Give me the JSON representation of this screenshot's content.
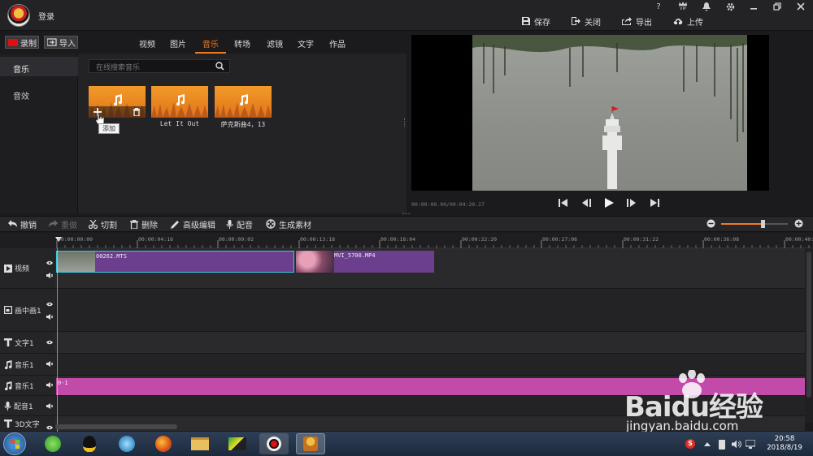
{
  "titlebar": {
    "login_label": "登录",
    "actions": [
      {
        "label": "保存",
        "icon": "save-icon"
      },
      {
        "label": "关闭",
        "icon": "close-project-icon"
      },
      {
        "label": "导出",
        "icon": "export-icon"
      },
      {
        "label": "上传",
        "icon": "upload-icon"
      }
    ],
    "vip_label": "VIP"
  },
  "toolbar": {
    "record_label": "录制",
    "import_label": "导入",
    "tabs": [
      "视频",
      "图片",
      "音乐",
      "转场",
      "滤镜",
      "文字",
      "作品"
    ],
    "active_tab": "音乐"
  },
  "library": {
    "categories": [
      "音乐",
      "音效"
    ],
    "search_placeholder": "在线搜索音乐",
    "items": [
      {
        "label": ""
      },
      {
        "label": "Let It Out"
      },
      {
        "label": "萨克斯曲4，13"
      }
    ],
    "tooltip": "添加"
  },
  "preview": {
    "timecode": "00:00:00.00/00:04:20.27"
  },
  "edit_toolbar": [
    {
      "label": "撤销",
      "icon": "undo-icon"
    },
    {
      "label": "重做",
      "icon": "redo-icon"
    },
    {
      "label": "切割",
      "icon": "scissors-icon"
    },
    {
      "label": "删除",
      "icon": "trash-icon"
    },
    {
      "label": "高级编辑",
      "icon": "pencil-icon"
    },
    {
      "label": "配音",
      "icon": "microphone-icon"
    },
    {
      "label": "生成素材",
      "icon": "reel-icon"
    }
  ],
  "zoom": {
    "level": 0.62
  },
  "timeline": {
    "ticks": [
      "00:00:00:00",
      "00:00:04:16",
      "00:00:09:02",
      "00:00:13:18",
      "00:00:18:04",
      "00:00:22:20",
      "00:00:27:06",
      "00:00:31:22",
      "00:00:36:08",
      "00:00:40:"
    ],
    "tracks": [
      {
        "label": "视频",
        "icon": "video-track-icon"
      },
      {
        "label": "画中画1",
        "icon": "pip-track-icon"
      },
      {
        "label": "文字1",
        "icon": "text-track-icon"
      },
      {
        "label": "音乐1",
        "icon": "music-track-icon"
      },
      {
        "label": "音乐1",
        "icon": "music-track-icon"
      },
      {
        "label": "配音1",
        "icon": "mic-track-icon"
      },
      {
        "label": "3D文字",
        "icon": "text3d-track-icon"
      }
    ],
    "video_clips": [
      {
        "label": "00262.MTS"
      },
      {
        "label": "MVI_5700.MP4"
      }
    ],
    "music_clip": {
      "label": "0-1"
    }
  },
  "taskbar": {
    "time": "20:58",
    "date": "2018/8/19"
  },
  "watermark": {
    "brand": "Baidu经验",
    "url": "jingyan.baidu.com"
  },
  "colors": {
    "accent": "#f07a20",
    "clip_video": "#6b3e8e",
    "clip_music": "#c24aa8",
    "selection": "#3cc8e0"
  }
}
